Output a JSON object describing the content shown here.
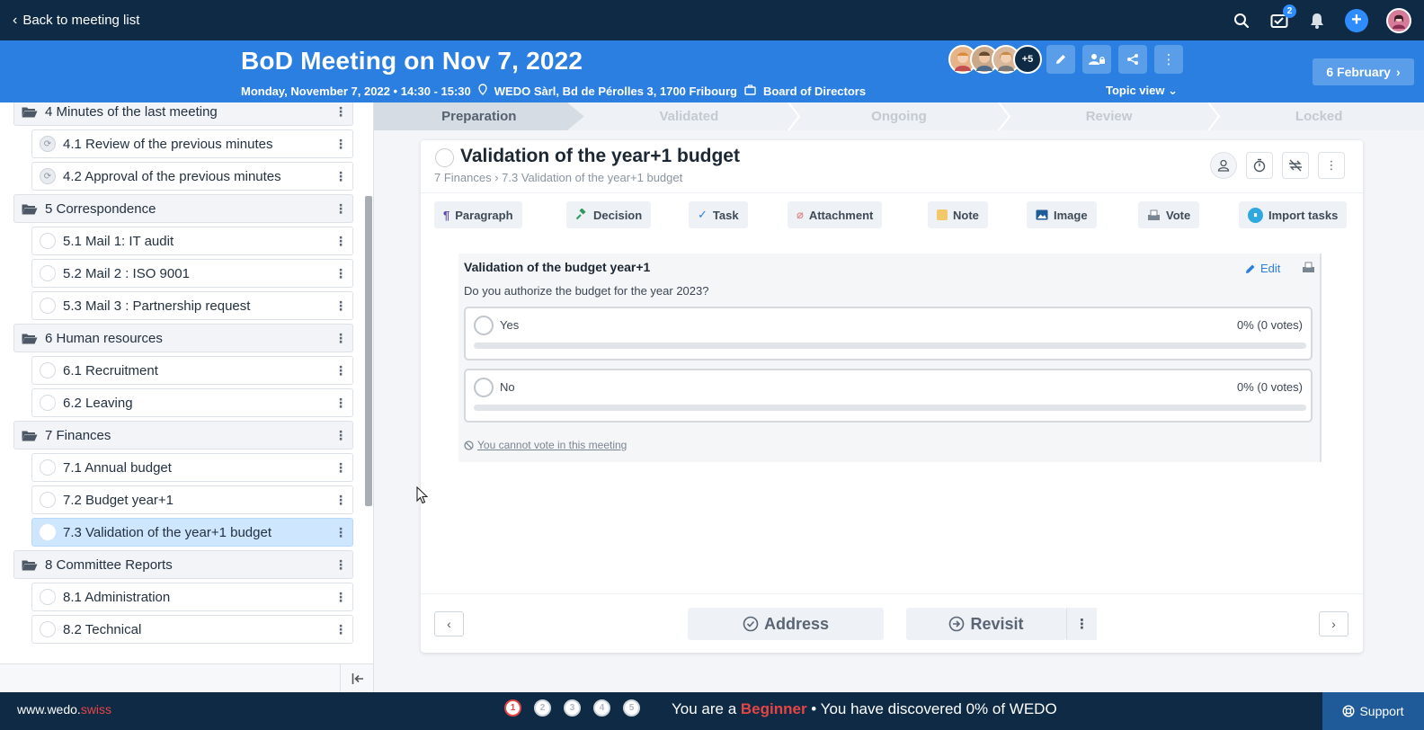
{
  "topbar": {
    "back_label": "Back to meeting list",
    "notif_count": "2"
  },
  "header": {
    "title": "BoD Meeting on Nov 7, 2022",
    "date_time": "Monday, November 7, 2022 • 14:30 - 15:30",
    "location": "WEDO Sàrl, Bd de Pérolles 3, 1700 Fribourg",
    "group": "Board of Directors",
    "extra_attendees": "+5",
    "topic_view": "Topic view",
    "next_date": "6 February"
  },
  "sidebar": {
    "rows": [
      {
        "type": "section",
        "label": "4 Minutes of the last meeting"
      },
      {
        "type": "item",
        "label": "4.1 Review of the previous minutes",
        "status": "sync"
      },
      {
        "type": "item",
        "label": "4.2 Approval of the previous minutes",
        "status": "sync"
      },
      {
        "type": "section",
        "label": "5 Correspondence"
      },
      {
        "type": "item",
        "label": "5.1 Mail 1: IT audit"
      },
      {
        "type": "item",
        "label": "5.2 Mail 2 : ISO 9001"
      },
      {
        "type": "item",
        "label": "5.3 Mail 3 : Partnership request"
      },
      {
        "type": "section",
        "label": "6 Human resources"
      },
      {
        "type": "item",
        "label": "6.1 Recruitment"
      },
      {
        "type": "item",
        "label": "6.2 Leaving"
      },
      {
        "type": "section",
        "label": "7 Finances"
      },
      {
        "type": "item",
        "label": "7.1 Annual budget"
      },
      {
        "type": "item",
        "label": "7.2 Budget year+1"
      },
      {
        "type": "item",
        "label": "7.3 Validation of the year+1 budget",
        "active": true
      },
      {
        "type": "section",
        "label": "8 Committee Reports"
      },
      {
        "type": "item",
        "label": "8.1 Administration"
      },
      {
        "type": "item",
        "label": "8.2 Technical"
      }
    ]
  },
  "stepper": {
    "steps": [
      "Preparation",
      "Validated",
      "Ongoing",
      "Review",
      "Locked"
    ],
    "current": 0
  },
  "topic": {
    "title": "Validation of the year+1 budget",
    "breadcrumb_section": "7 Finances",
    "breadcrumb_item": "7.3 Validation of the year+1 budget"
  },
  "blocks": {
    "paragraph": "Paragraph",
    "decision": "Decision",
    "task": "Task",
    "attachment": "Attachment",
    "note": "Note",
    "image": "Image",
    "vote": "Vote",
    "import_tasks": "Import tasks"
  },
  "vote": {
    "title": "Validation of the budget year+1",
    "question": "Do you authorize the budget for the year 2023?",
    "edit_label": "Edit",
    "options": [
      {
        "label": "Yes",
        "result": "0% (0 votes)",
        "percent": 0
      },
      {
        "label": "No",
        "result": "0% (0 votes)",
        "percent": 0
      }
    ],
    "restriction": "You cannot vote in this meeting"
  },
  "actions": {
    "address": "Address",
    "revisit": "Revisit"
  },
  "footer": {
    "url_main": "www.wedo.",
    "url_tld": "swiss",
    "steps": [
      "1",
      "2",
      "3",
      "4",
      "5"
    ],
    "msg_prefix": "You are a ",
    "level": "Beginner",
    "msg_suffix": " • You have discovered 0% of WEDO",
    "support": "Support"
  },
  "colors": {
    "navy": "#0e2a44",
    "brand_blue": "#2b7fe1",
    "active_row": "#cfe6ff",
    "accent_red": "#e64545"
  }
}
